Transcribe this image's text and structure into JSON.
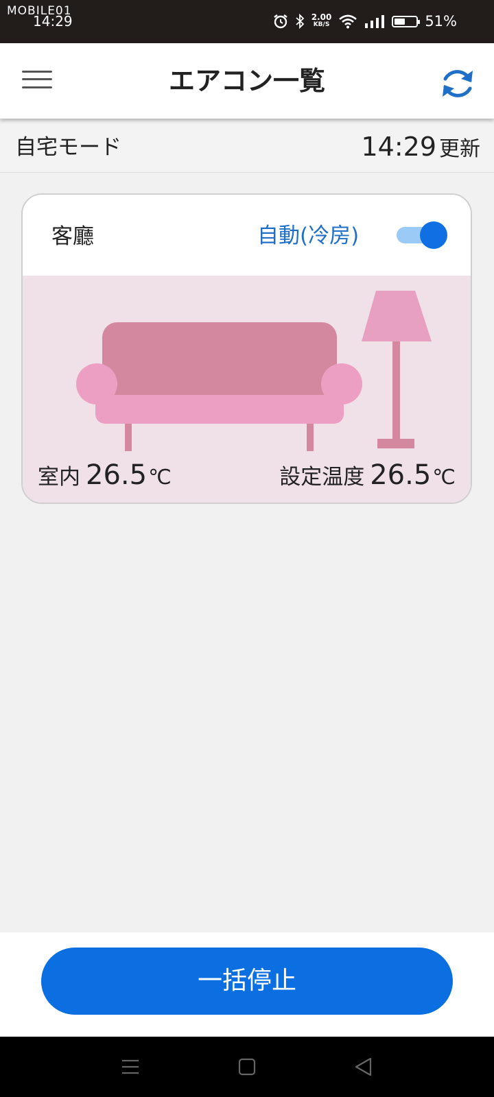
{
  "status_bar": {
    "brand": "MOBILE01",
    "time": "14:29",
    "speed_value": "2.00",
    "speed_unit": "KB/S",
    "battery_percent": "51%",
    "battery_level": 0.51,
    "icons": [
      "alarm-icon",
      "bluetooth-icon",
      "wifi-icon",
      "signal-icon",
      "battery-icon"
    ]
  },
  "app_bar": {
    "title": "エアコン一覧",
    "menu_icon": "hamburger-menu-icon",
    "refresh_icon": "refresh-icon"
  },
  "mode_bar": {
    "mode": "自宅モード",
    "updated_time": "14:29",
    "updated_suffix": "更新"
  },
  "rooms": [
    {
      "name": "客廳",
      "operation_mode": "自動(冷房)",
      "power_on": true,
      "scene": "living-room-sofa-lamp",
      "indoor_label": "室内",
      "indoor_temp": "26.5",
      "setpoint_label": "設定温度",
      "setpoint_temp": "26.5",
      "unit": "℃"
    }
  ],
  "actions": {
    "stop_all": "一括停止"
  },
  "colors": {
    "accent": "#0b6fe2",
    "mode_text": "#1f6fc9",
    "scene_bg": "#f0e0e8",
    "sofa_back": "#d4889f",
    "sofa_seat": "#ec9fc2",
    "lamp": "#e8a0c0"
  },
  "nav_bar": {
    "icons": [
      "recents-icon",
      "home-icon",
      "back-icon"
    ]
  }
}
